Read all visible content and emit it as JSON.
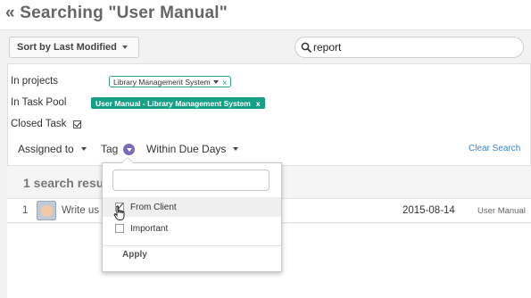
{
  "page": {
    "title": "« Searching \"User Manual\""
  },
  "toolbar": {
    "sort_label": "Sort by Last Modified"
  },
  "search": {
    "value": "report"
  },
  "filters": {
    "projects_label": "In projects",
    "projects_tag": "Library Management System",
    "projects_tag_remove": "x",
    "taskpool_label": "In Task Pool",
    "taskpool_tag": "User Manual - Library Management System",
    "taskpool_tag_remove": "x",
    "closed_label": "Closed Task",
    "closed_checked": true
  },
  "filter_tabs": {
    "assigned_to": "Assigned to",
    "tag": "Tag",
    "due_days": "Within Due Days"
  },
  "clear_search": "Clear Search",
  "results": {
    "count_label": "1 search resu",
    "rows": [
      {
        "num": "1",
        "title": "Write us",
        "date": "2015-08-14",
        "pool": "User Manual"
      }
    ]
  },
  "tag_dropdown": {
    "search_value": "",
    "items": [
      {
        "label": "From Client",
        "checked": true
      },
      {
        "label": "Important",
        "checked": false
      }
    ],
    "apply_label": "Apply"
  },
  "colors": {
    "tag_green": "#16a085",
    "tag_purple": "#7b6ab4",
    "link_blue": "#3a85c8"
  }
}
